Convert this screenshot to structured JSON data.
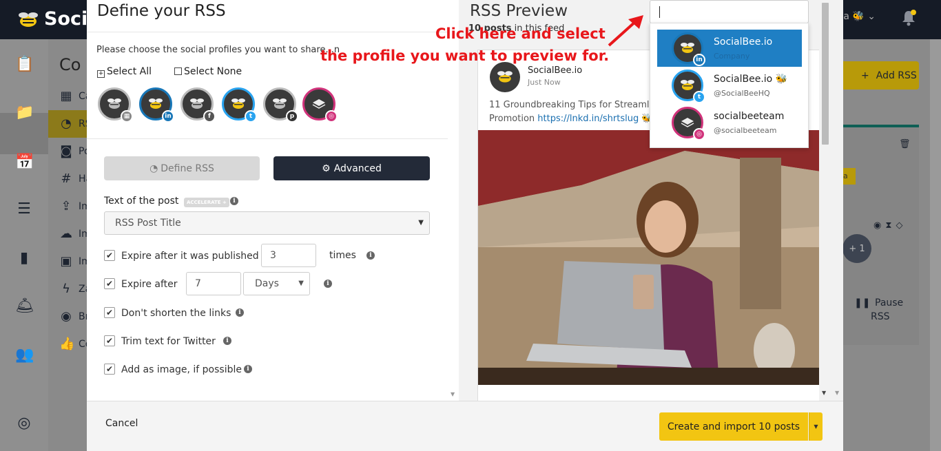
{
  "app": {
    "logo_text": "Soci",
    "user_partial": "a",
    "bg_subnav_title": "Co"
  },
  "bg_subnav": [
    "Ca",
    "RS",
    "Po",
    "Ha",
    "Im",
    "Im",
    "Im",
    "Za",
    "Br",
    "Co"
  ],
  "bg_right": {
    "add_rss": "Add RSS",
    "badge": "a",
    "plus_one": "+ 1",
    "pause_line1": "Pause",
    "pause_line2": "RSS"
  },
  "modal": {
    "title": "Define your RSS",
    "choose_text": "Please choose the social profiles you want to share...n",
    "select_all": "Select All",
    "select_none": "Select None",
    "profiles": [
      {
        "network": "google-business",
        "badge_color": "#888888"
      },
      {
        "network": "linkedin",
        "badge_color": "#1877b8"
      },
      {
        "network": "facebook",
        "badge_color": "#555555"
      },
      {
        "network": "twitter",
        "badge_color": "#29a3ef"
      },
      {
        "network": "pinterest",
        "badge_color": "#333333"
      },
      {
        "network": "instagram",
        "badge_color": "#d1337b"
      }
    ],
    "tabs": {
      "define": "Define RSS",
      "advanced": "Advanced"
    },
    "text_of_post_label": "Text of the post",
    "accelerate_badge": "ACCELERATE +",
    "text_of_post_value": "RSS Post Title",
    "options": {
      "expire_published": "Expire after it was published",
      "expire_published_value": "3",
      "times": "times",
      "expire_after": "Expire after",
      "expire_after_value": "7",
      "expire_unit": "Days",
      "dont_shorten": "Don't shorten the links",
      "trim_twitter": "Trim text for Twitter",
      "add_image": "Add as image, if possible"
    }
  },
  "preview": {
    "title": "RSS Preview",
    "posts_count": "10 posts",
    "posts_suffix": " in this feed",
    "post": {
      "name": "SocialBee.io",
      "time": "Just Now",
      "text": "11 Groundbreaking Tips for Streamlini",
      "text2": "Promotion ",
      "link": "https://lnkd.in/shrtslug",
      "emoji": "🐝"
    }
  },
  "dropdown": {
    "items": [
      {
        "name": "SocialBee.io",
        "sub": "Company",
        "network": "linkedin",
        "badge_color": "#1877b8",
        "selected": true
      },
      {
        "name": "SocialBee.io 🐝",
        "sub": "@SocialBeeHQ",
        "network": "twitter",
        "badge_color": "#29a3ef",
        "selected": false
      },
      {
        "name": "socialbeeteam",
        "sub": "@socialbeeteam",
        "network": "instagram",
        "badge_color": "#d1337b",
        "selected": false
      }
    ]
  },
  "annotation": {
    "line1": "Click here and select",
    "line2": "the profile you want to preview for.",
    "color": "#e8171b"
  },
  "footer": {
    "cancel": "Cancel",
    "create": "Create and import 10 posts"
  },
  "colors": {
    "accent_yellow": "#f2c512",
    "dark": "#232a38",
    "link": "#1a6fb0"
  }
}
